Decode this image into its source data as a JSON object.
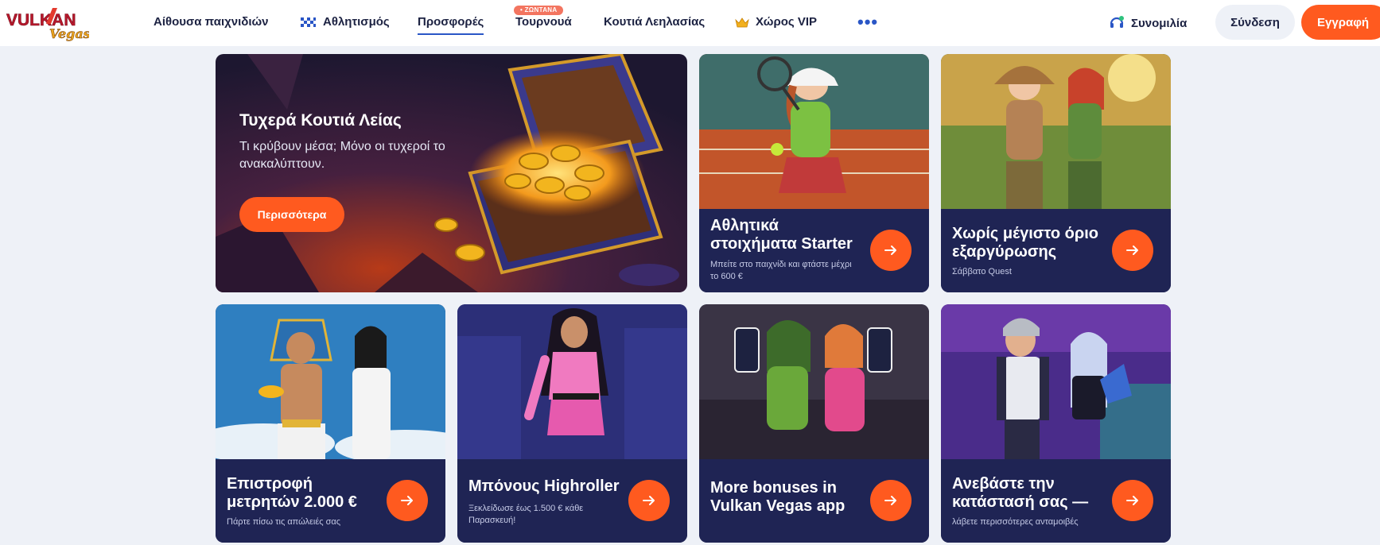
{
  "brand": {
    "logo_main": "VULKAN",
    "logo_script": "Vegas"
  },
  "nav": {
    "items": [
      {
        "label": "Αίθουσα παιχνιδιών"
      },
      {
        "label": "Αθλητισμός"
      },
      {
        "label": "Προσφορές"
      },
      {
        "label": "Τουρνουά"
      },
      {
        "label": "Κουτιά Λεηλασίας"
      },
      {
        "label": "Χώρος VIP"
      }
    ],
    "live_badge": "• ΖΩΝΤΑΝΑ",
    "more_label": "•••"
  },
  "header": {
    "chat_label": "Συνομιλία",
    "login_label": "Σύνδεση",
    "register_label": "Εγγραφή"
  },
  "hero": {
    "title": "Τυχερά Κουτιά Λείας",
    "subtitle": "Τι κρύβουν μέσα; Μόνο οι τυχεροί το ανακαλύπτουν.",
    "button": "Περισσότερα"
  },
  "cards": [
    {
      "title": "Αθλητικά στοιχήματα Starter",
      "subtitle": "Μπείτε στο παιχνίδι και φτάστε μέχρι το 600 €"
    },
    {
      "title": "Χωρίς μέγιστο όριο εξαργύρωσης",
      "subtitle": "Σάββατο Quest"
    },
    {
      "title": "Επιστροφή μετρητών 2.000 €",
      "subtitle": "Πάρτε πίσω τις απώλειές σας"
    },
    {
      "title": "Μπόνους Highroller",
      "subtitle": "Ξεκλείδωσε έως 1.500 € κάθε Παρασκευή!"
    },
    {
      "title": "More bonuses in Vulkan Vegas app",
      "subtitle": ""
    },
    {
      "title": "Ανεβάστε την κατάστασή σας —",
      "subtitle": "λάβετε περισσότερες ανταμοιβές"
    }
  ],
  "colors": {
    "accent": "#ff5a1f",
    "navy": "#1f2454",
    "link": "#2a56c6",
    "page_bg": "#eef1f7"
  }
}
